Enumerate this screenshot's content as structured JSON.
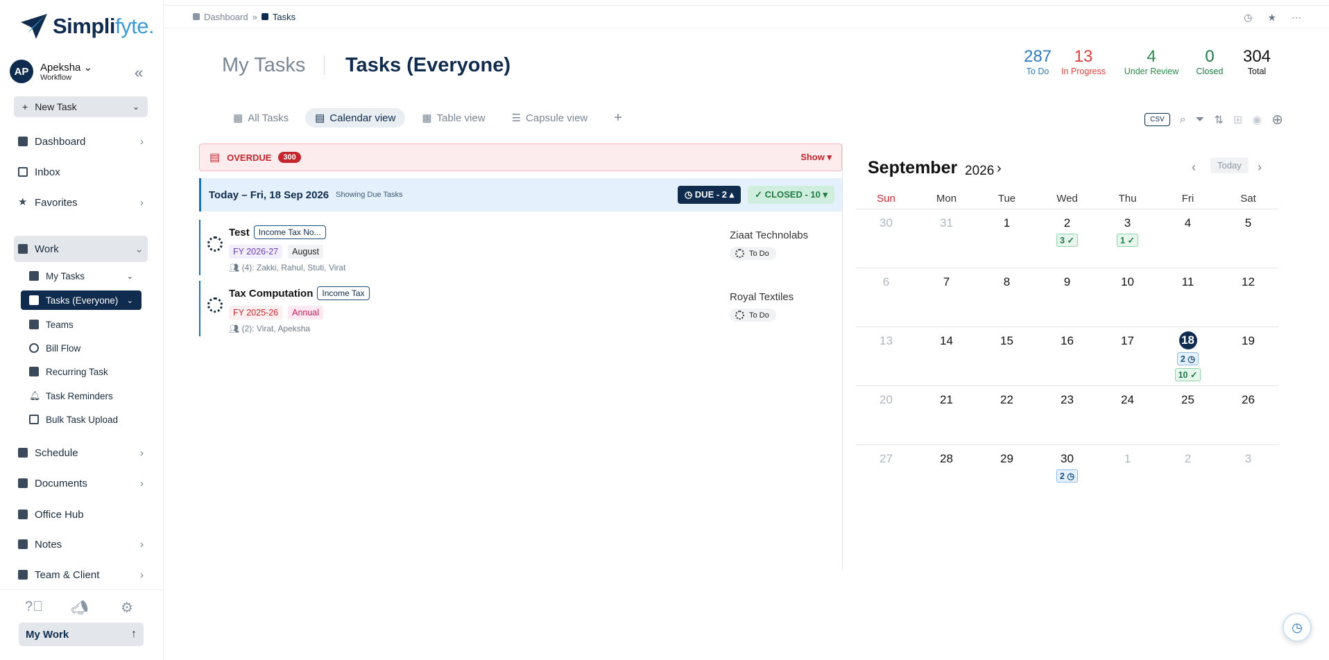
{
  "app": {
    "brand_main": "Simpli",
    "brand_accent": "fyte."
  },
  "user": {
    "initials": "AP",
    "name": "Apeksha",
    "role": "Workflow"
  },
  "sidebar": {
    "new_task": "New Task",
    "items": [
      {
        "label": "Dashboard"
      },
      {
        "label": "Inbox"
      },
      {
        "label": "Favorites"
      },
      {
        "label": "Work"
      },
      {
        "label": "Schedule"
      },
      {
        "label": "Documents"
      },
      {
        "label": "Office Hub"
      },
      {
        "label": "Notes"
      },
      {
        "label": "Team & Client"
      }
    ],
    "work_sub": [
      {
        "label": "My Tasks"
      },
      {
        "label": "Tasks (Everyone)"
      },
      {
        "label": "Teams"
      },
      {
        "label": "Bill Flow"
      },
      {
        "label": "Recurring Task"
      },
      {
        "label": "Task Reminders"
      },
      {
        "label": "Bulk Task Upload"
      }
    ],
    "my_work": "My Work"
  },
  "breadcrumb": {
    "root": "Dashboard",
    "current": "Tasks"
  },
  "header": {
    "my_tasks": "My Tasks",
    "everyone": "Tasks (Everyone)"
  },
  "stats": [
    {
      "value": "287",
      "label": "To Do",
      "color": "#2a7bbf"
    },
    {
      "value": "13",
      "label": "In Progress",
      "color": "#d8403a"
    },
    {
      "value": "4",
      "label": "Under Review",
      "color": "#2b8a4b"
    },
    {
      "value": "0",
      "label": "Closed",
      "color": "#1f7a44"
    },
    {
      "value": "304",
      "label": "Total",
      "color": "#111111"
    }
  ],
  "tabs": [
    {
      "label": "All Tasks"
    },
    {
      "label": "Calendar view"
    },
    {
      "label": "Table view"
    },
    {
      "label": "Capsule view"
    }
  ],
  "toolbar": {
    "csv": "CSV"
  },
  "overdue": {
    "label": "OVERDUE",
    "count": "300",
    "show": "Show ▾"
  },
  "today": {
    "title": "Today – Fri, 18 Sep 2026",
    "subtitle": "Showing Due Tasks",
    "due": "DUE - 2 ▴",
    "closed": "✓ CLOSED - 10 ▾"
  },
  "tasks": [
    {
      "name": "Test",
      "tag": "Income Tax No...",
      "fy": "FY 2026-27",
      "period": "August",
      "people": "(4): Zakki, Rahul, Stuti, Virat",
      "client": "Ziaat Technolabs",
      "status": "To Do"
    },
    {
      "name": "Tax Computation",
      "tag": "Income Tax",
      "fy": "FY 2025-26",
      "period": "Annual",
      "people": "(2): Virat, Apeksha",
      "client": "Royal Textiles",
      "status": "To Do"
    }
  ],
  "calendar": {
    "month": "September",
    "year": "2026",
    "today_btn": "Today",
    "dow": [
      "Sun",
      "Mon",
      "Tue",
      "Wed",
      "Thu",
      "Fri",
      "Sat"
    ],
    "weeks": [
      [
        {
          "d": "30",
          "m": true
        },
        {
          "d": "31",
          "m": true
        },
        {
          "d": "1"
        },
        {
          "d": "2",
          "c": "3 ✓",
          "k": "g"
        },
        {
          "d": "3",
          "c": "1 ✓",
          "k": "g"
        },
        {
          "d": "4"
        },
        {
          "d": "5"
        }
      ],
      [
        {
          "d": "6",
          "m": true
        },
        {
          "d": "7"
        },
        {
          "d": "8"
        },
        {
          "d": "9"
        },
        {
          "d": "10"
        },
        {
          "d": "11"
        },
        {
          "d": "12"
        }
      ],
      [
        {
          "d": "13",
          "m": true
        },
        {
          "d": "14"
        },
        {
          "d": "15"
        },
        {
          "d": "16"
        },
        {
          "d": "17"
        },
        {
          "d": "18",
          "t": true,
          "c": "2 ◷",
          "k": "b",
          "c2": "10 ✓",
          "k2": "g"
        },
        {
          "d": "19"
        }
      ],
      [
        {
          "d": "20",
          "m": true
        },
        {
          "d": "21"
        },
        {
          "d": "22"
        },
        {
          "d": "23"
        },
        {
          "d": "24"
        },
        {
          "d": "25"
        },
        {
          "d": "26"
        }
      ],
      [
        {
          "d": "27",
          "m": true
        },
        {
          "d": "28"
        },
        {
          "d": "29"
        },
        {
          "d": "30",
          "c": "2 ◷",
          "k": "b"
        },
        {
          "d": "1",
          "m": true
        },
        {
          "d": "2",
          "m": true
        },
        {
          "d": "3",
          "m": true
        }
      ]
    ]
  }
}
